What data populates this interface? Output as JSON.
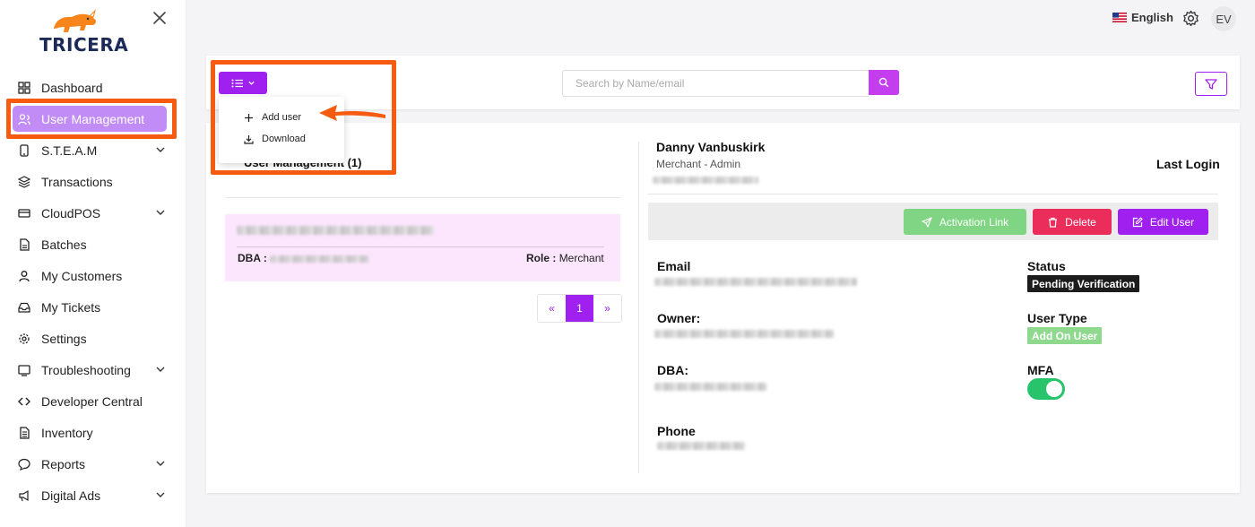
{
  "app": {
    "brand": "TRICERA"
  },
  "topbar": {
    "language": "English",
    "avatar_initials": "EV"
  },
  "sidebar": {
    "items": [
      {
        "label": "Dashboard",
        "icon": "grid-icon",
        "expandable": false,
        "active": false
      },
      {
        "label": "User Management",
        "icon": "users-icon",
        "expandable": false,
        "active": true
      },
      {
        "label": "S.T.E.A.M",
        "icon": "phone-icon",
        "expandable": true,
        "active": false
      },
      {
        "label": "Transactions",
        "icon": "layers-icon",
        "expandable": false,
        "active": false
      },
      {
        "label": "CloudPOS",
        "icon": "credit-card-icon",
        "expandable": true,
        "active": false
      },
      {
        "label": "Batches",
        "icon": "file-icon",
        "expandable": false,
        "active": false
      },
      {
        "label": "My Customers",
        "icon": "user-icon",
        "expandable": false,
        "active": false
      },
      {
        "label": "My Tickets",
        "icon": "inbox-icon",
        "expandable": false,
        "active": false
      },
      {
        "label": "Settings",
        "icon": "gear-icon",
        "expandable": false,
        "active": false
      },
      {
        "label": "Troubleshooting",
        "icon": "tool-icon",
        "expandable": true,
        "active": false
      },
      {
        "label": "Developer Central",
        "icon": "code-icon",
        "expandable": false,
        "active": false
      },
      {
        "label": "Inventory",
        "icon": "document-icon",
        "expandable": false,
        "active": false
      },
      {
        "label": "Reports",
        "icon": "chat-icon",
        "expandable": true,
        "active": false
      },
      {
        "label": "Digital Ads",
        "icon": "megaphone-icon",
        "expandable": true,
        "active": false
      }
    ]
  },
  "toolbar": {
    "search_placeholder": "Search by Name/email",
    "menu": {
      "add_user": "Add user",
      "download": "Download"
    }
  },
  "list": {
    "title": "User Management (1)",
    "row": {
      "dba_label": "DBA :",
      "role_label": "Role :",
      "role_value": "Merchant"
    },
    "pager": {
      "prev": "«",
      "current": "1",
      "next": "»"
    }
  },
  "details": {
    "name": "Danny Vanbuskirk",
    "role": "Merchant - Admin",
    "last_login_label": "Last Login",
    "buttons": {
      "activation": "Activation Link",
      "delete": "Delete",
      "edit": "Edit User"
    },
    "fields": {
      "email_label": "Email",
      "owner_label": "Owner:",
      "dba_label": "DBA:",
      "phone_label": "Phone",
      "status_label": "Status",
      "status_value": "Pending Verification",
      "user_type_label": "User Type",
      "user_type_value": "Add On User",
      "mfa_label": "MFA",
      "mfa_enabled": true
    }
  },
  "colors": {
    "accent": "#a020f0",
    "highlight": "#f75b12",
    "success": "#7fd583",
    "danger": "#eb2d5b"
  }
}
